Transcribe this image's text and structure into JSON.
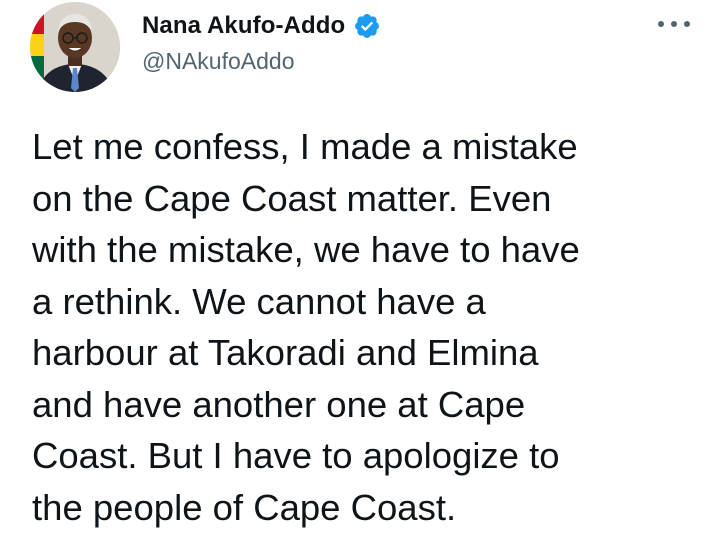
{
  "tweet": {
    "author": {
      "display_name": "Nana Akufo-Addo",
      "handle": "@NAkufoAddo",
      "verified": true
    },
    "text_lines": [
      "Let me confess, I made a mistake",
      "on the Cape Coast matter. Even",
      "with the mistake, we have to have",
      "a rethink. We cannot have a",
      "harbour at Takoradi and Elmina",
      "and have another one at Cape",
      "Coast. But I have to apologize to",
      "the people of Cape Coast."
    ]
  },
  "icons": {
    "verified": "verified-badge-icon",
    "more": "more-options-icon"
  },
  "colors": {
    "verified_blue": "#1d9bf0",
    "text": "#0f1419",
    "secondary_text": "#536471"
  }
}
